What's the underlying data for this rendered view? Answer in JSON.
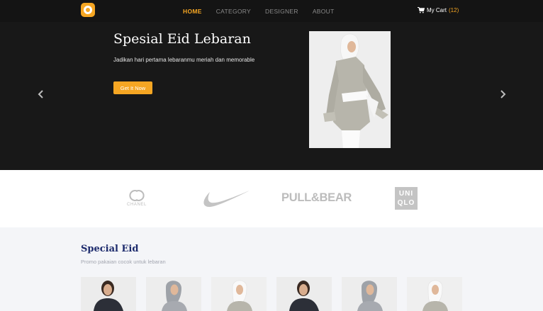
{
  "navbar": {
    "logo_icon": "camera-lens-logo",
    "links": [
      {
        "label": "HOME",
        "active": true
      },
      {
        "label": "CATEGORY",
        "active": false
      },
      {
        "label": "DESIGNER",
        "active": false
      },
      {
        "label": "ABOUT",
        "active": false
      }
    ],
    "cart": {
      "icon": "cart-icon",
      "label": "My Cart",
      "count": "(12)"
    }
  },
  "hero": {
    "title": "Spesial Eid Lebaran",
    "description": "Jadikan hari pertama lebaranmu meriah dan memorable",
    "button_label": "Get It Now",
    "image": "model-in-grey-tunic-and-white-hijab",
    "prev_icon": "chevron-left-icon",
    "next_icon": "chevron-right-icon"
  },
  "brands": {
    "chanel": "CHANEL",
    "nike_logo": "nike-swoosh",
    "pullbear": "PULL&BEAR",
    "uniqlo_line1": "UNI",
    "uniqlo_line2": "QLO"
  },
  "section": {
    "title": "Special Eid",
    "subtitle": "Promo pakaian cocok untuk lebaran",
    "products": [
      {
        "image": "model-dark-top"
      },
      {
        "image": "model-grey-hijab"
      },
      {
        "image": "model-grey-tunic"
      },
      {
        "image": "model-dark-top"
      },
      {
        "image": "model-grey-hijab"
      },
      {
        "image": "model-grey-tunic"
      }
    ]
  },
  "colors": {
    "accent": "#f5a623",
    "navy": "#1c2a6c",
    "dark_bg": "#181818"
  }
}
